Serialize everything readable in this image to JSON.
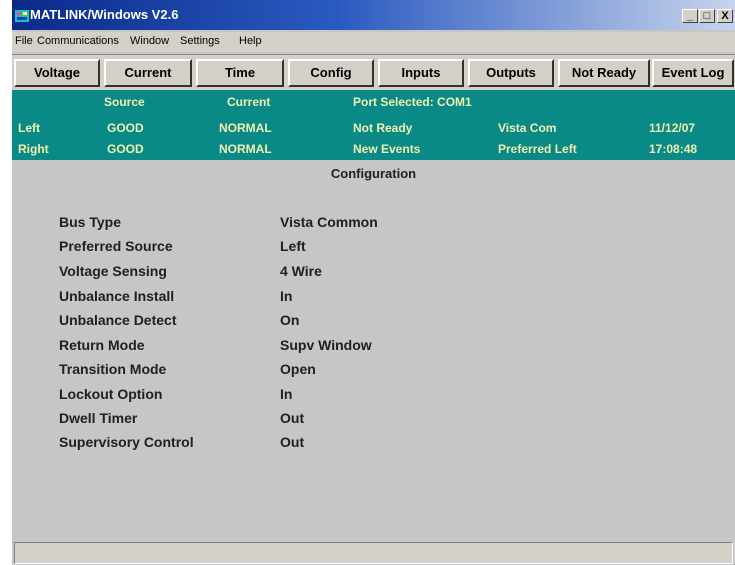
{
  "window": {
    "title": "MATLINK/Windows V2.6",
    "controls": {
      "minimize": "_",
      "maximize": "□",
      "close": "X"
    }
  },
  "menu": [
    "File",
    "Communications",
    "Window",
    "Settings",
    "Help"
  ],
  "toolbar": [
    "Voltage",
    "Current",
    "Time",
    "Config",
    "Inputs",
    "Outputs",
    "Not Ready",
    "Event Log"
  ],
  "status": {
    "source_header": "Source",
    "current_header": "Current",
    "port_selected": "Port Selected: COM1",
    "left": {
      "label": "Left",
      "source": "GOOD",
      "current": "NORMAL",
      "state": "Not Ready",
      "bus": "Vista Com",
      "date": "11/12/07"
    },
    "right": {
      "label": "Right",
      "source": "GOOD",
      "current": "NORMAL",
      "state": "New Events",
      "preferred": "Preferred Left",
      "time": "17:08:48"
    }
  },
  "config": {
    "title": "Configuration",
    "rows": [
      {
        "label": "Bus Type",
        "value": "Vista Common"
      },
      {
        "label": "Preferred Source",
        "value": "Left"
      },
      {
        "label": "Voltage Sensing",
        "value": "4 Wire"
      },
      {
        "label": "Unbalance Install",
        "value": "In"
      },
      {
        "label": "Unbalance Detect",
        "value": "On"
      },
      {
        "label": "Return Mode",
        "value": "Supv Window"
      },
      {
        "label": "Transition Mode",
        "value": "Open"
      },
      {
        "label": "Lockout Option",
        "value": "In"
      },
      {
        "label": "Dwell Timer",
        "value": "Out"
      },
      {
        "label": "Supervisory Control",
        "value": "Out"
      }
    ]
  },
  "colors": {
    "status_bg": "#0a8a86",
    "status_text": "#f0f0b0",
    "panel": "#c6c6c6"
  },
  "statusbar": ""
}
